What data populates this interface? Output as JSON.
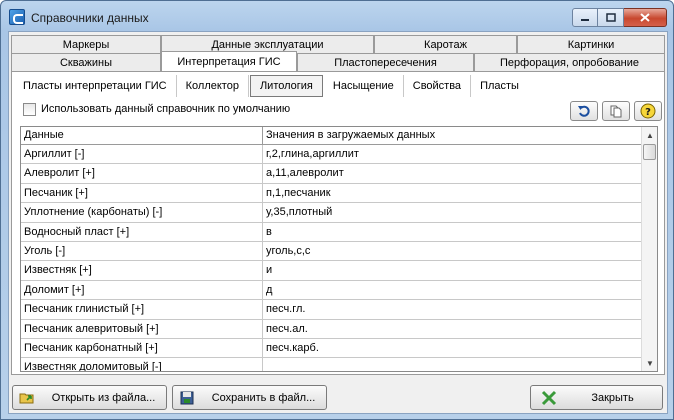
{
  "window": {
    "title": "Справочники данных"
  },
  "tabs_row1": [
    {
      "label": "Маркеры"
    },
    {
      "label": "Данные эксплуатации"
    },
    {
      "label": "Каротаж"
    },
    {
      "label": "Картинки"
    }
  ],
  "tabs_row2": [
    {
      "label": "Скважины"
    },
    {
      "label": "Интерпретация ГИС"
    },
    {
      "label": "Пластопересечения"
    },
    {
      "label": "Перфорация, опробование"
    }
  ],
  "subtabs": [
    {
      "label": "Пласты интерпретации ГИС"
    },
    {
      "label": "Коллектор"
    },
    {
      "label": "Литология"
    },
    {
      "label": "Насыщение"
    },
    {
      "label": "Свойства"
    },
    {
      "label": "Пласты"
    }
  ],
  "toolbar": {
    "use_default_label": "Использовать данный справочник по умолчанию"
  },
  "grid": {
    "columns": [
      "Данные",
      "Значения в загружаемых данных"
    ],
    "rows": [
      [
        "Аргиллит [-]",
        "г,2,глина,аргиллит"
      ],
      [
        "Алевролит [+]",
        "а,11,алевролит"
      ],
      [
        "Песчаник [+]",
        "п,1,песчаник"
      ],
      [
        "Уплотнение (карбонаты) [-]",
        "у,35,плотный"
      ],
      [
        "Водносный пласт [+]",
        "в"
      ],
      [
        "Уголь [-]",
        "уголь,с,с"
      ],
      [
        "Известняк [+]",
        "и"
      ],
      [
        "Доломит [+]",
        "д"
      ],
      [
        "Песчаник глинистый [+]",
        "песч.гл."
      ],
      [
        "Песчаник алевритовый [+]",
        "песч.ал."
      ],
      [
        "Песчаник карбонатный [+]",
        "песч.карб."
      ],
      [
        "Известняк доломитовый [-]",
        ""
      ]
    ]
  },
  "buttons": {
    "open": "Открыть из файла...",
    "save": "Сохранить в файл...",
    "close": "Закрыть"
  },
  "colors": {
    "title_bar": "#b7d0ea",
    "close_button": "#c8482f"
  }
}
